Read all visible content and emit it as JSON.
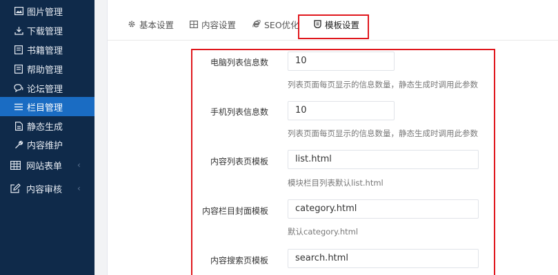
{
  "sidebar": {
    "items": [
      {
        "label": "图片管理",
        "icon": "image-icon"
      },
      {
        "label": "下载管理",
        "icon": "download-icon"
      },
      {
        "label": "书籍管理",
        "icon": "book-icon"
      },
      {
        "label": "帮助管理",
        "icon": "help-icon"
      },
      {
        "label": "论坛管理",
        "icon": "forum-icon"
      },
      {
        "label": "栏目管理",
        "icon": "menu-icon"
      },
      {
        "label": "静态生成",
        "icon": "file-icon"
      },
      {
        "label": "内容维护",
        "icon": "wrench-icon"
      },
      {
        "label": "网站表单",
        "icon": "grid-icon"
      },
      {
        "label": "内容审核",
        "icon": "edit-icon"
      }
    ],
    "active_index": 5,
    "chevron": "‹"
  },
  "tabs": [
    {
      "label": "基本设置",
      "icon": "gear-icon"
    },
    {
      "label": "内容设置",
      "icon": "table-icon"
    },
    {
      "label": "SEO优化",
      "icon": "ie-icon"
    },
    {
      "label": "模板设置",
      "icon": "template-icon"
    }
  ],
  "active_tab": 3,
  "form": {
    "pc_list_count": {
      "label": "电脑列表信息数",
      "value": "10",
      "hint": "列表页面每页显示的信息数量，静态生成时调用此参数"
    },
    "mobile_list_count": {
      "label": "手机列表信息数",
      "value": "10",
      "hint": "列表页面每页显示的信息数量，静态生成时调用此参数"
    },
    "list_template": {
      "label": "内容列表页模板",
      "value": "list.html",
      "hint": "模块栏目列表默认list.html"
    },
    "category_template": {
      "label": "内容栏目封面模板",
      "value": "category.html",
      "hint": "默认category.html"
    },
    "search_template": {
      "label": "内容搜索页模板",
      "value": "search.html"
    }
  },
  "colors": {
    "sidebar_bg": "#0f2a4a",
    "sidebar_active": "#1a6cc3",
    "highlight": "#e0161c"
  }
}
